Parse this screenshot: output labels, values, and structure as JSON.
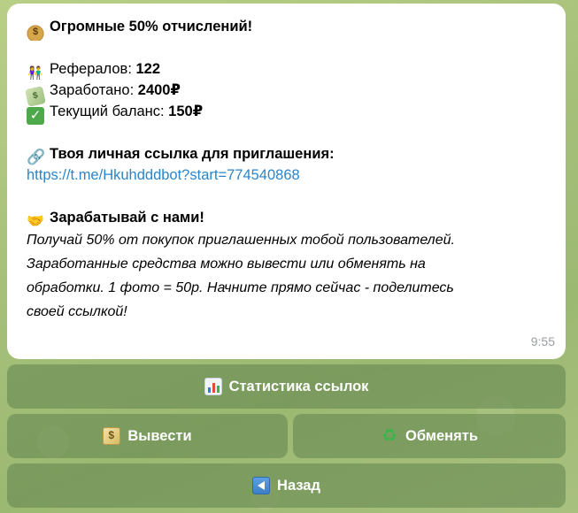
{
  "message": {
    "title": "Огромные 50% отчислений!",
    "referrals_label": "Рефералов: ",
    "referrals_value": "122",
    "earned_label": "Заработано: ",
    "earned_value": "2400₽",
    "balance_label": "Текущий баланс: ",
    "balance_value": "150₽",
    "link_heading": "Твоя личная ссылка для приглашения:",
    "link_url": "https://t.me/Hkuhdddbot?start=774540868",
    "earn_heading": "Зарабатывай с нами!",
    "description_lines": [
      "Получай 50% от покупок приглашенных тобой пользователей.",
      "Заработанные средства можно вывести или обменять на",
      "обработки. 1 фото = 50р. Начните прямо сейчас - поделитесь",
      "своей ссылкой!"
    ],
    "time": "9:55"
  },
  "icons": {
    "title_icon": "money-bag-icon",
    "referrals_icon": "people-icon",
    "earned_icon": "cash-icon",
    "balance_icon": "check-icon",
    "link_icon": "link-icon",
    "earn_icon": "handshake-icon"
  },
  "keyboard": {
    "stats_label": "Статистика ссылок",
    "withdraw_label": "Вывести",
    "exchange_label": "Обменять",
    "back_label": "Назад"
  },
  "colors": {
    "link": "#2b85c9",
    "button_bg": "#60844e",
    "wallpaper": "#a6c07a"
  }
}
